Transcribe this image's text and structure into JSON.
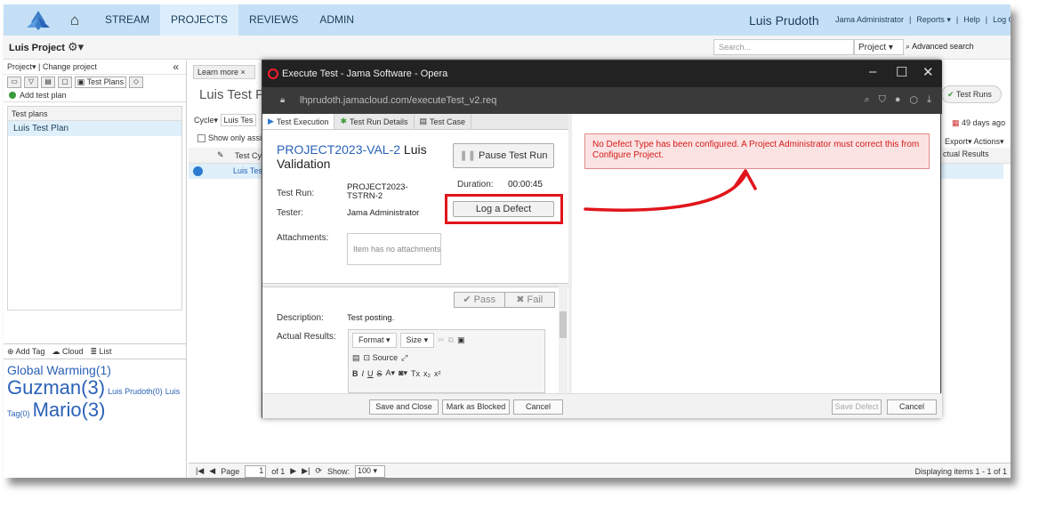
{
  "topnav": {
    "items": [
      "STREAM",
      "PROJECTS",
      "REVIEWS",
      "ADMIN"
    ],
    "user": "Luis Prudoth",
    "right_links": [
      "Jama Administrator",
      "|",
      "Reports ▾",
      "|",
      "Help",
      "|",
      "Log Out"
    ]
  },
  "projbar": {
    "project": "Luis Project",
    "search_placeholder": "Search...",
    "scope": "Project",
    "advanced": "Advanced search"
  },
  "left": {
    "header": "Project▾ | Change project",
    "tab_plans": "Test Plans",
    "add_plan": "Add test plan",
    "list_header": "Test plans",
    "items": [
      "Luis Test Plan"
    ],
    "tagbar": [
      "Add Tag",
      "Cloud",
      "List"
    ],
    "tags": [
      "Global Warming(1)",
      "Guzman(3)",
      "Luis Prudoth(0)",
      "Luis Tag(0)",
      "Mario(3)"
    ]
  },
  "center": {
    "learn": "Learn more",
    "title": "Luis Test Pla",
    "cycle_label": "Cycle▾",
    "cycle_value": "Luis Tes",
    "show_only": "Show only assig",
    "col_cycle": "Test Cyc",
    "row_text": "Luis Test",
    "test_runs": "Test Runs",
    "days_ago": "49 days ago",
    "export": "Export▾",
    "actions": "Actions▾",
    "actual_results": "ctual Results",
    "page_label": "Page",
    "page_value": "1",
    "of": "of 1",
    "show_label": "Show:",
    "show_value": "100",
    "displaying": "Displaying items 1 - 1 of 1"
  },
  "modal": {
    "title": "Execute Test - Jama Software - Opera",
    "url": "lhprudoth.jamacloud.com/executeTest_v2.req",
    "tabs": [
      "Test Execution",
      "Test Run Details",
      "Test Case"
    ],
    "proj_id": "PROJECT2023-VAL-2",
    "proj_name": "Luis Validation",
    "pause": "Pause Test Run",
    "test_run_label": "Test Run:",
    "test_run_value": "PROJECT2023-TSTRN-2",
    "duration_label": "Duration:",
    "duration_value": "00:00:45",
    "tester_label": "Tester:",
    "tester_value": "Jama Administrator",
    "log_defect": "Log a Defect",
    "attachments_label": "Attachments:",
    "attachments_value": "Item has no attachments",
    "pass": "Pass",
    "fail": "Fail",
    "description_label": "Description:",
    "description_value": "Test posting.",
    "actual_label": "Actual Results:",
    "format": "Format",
    "size": "Size",
    "source": "Source",
    "save_close": "Save and Close",
    "mark_blocked": "Mark as Blocked",
    "cancel": "Cancel",
    "error": "No Defect Type has been configured. A Project Administrator must correct this from Configure Project.",
    "save_defect": "Save Defect",
    "cancel2": "Cancel"
  },
  "colors": {
    "accent_red": "#e1141b",
    "nav_bg": "#c5e0f6",
    "link": "#2a62b8"
  }
}
